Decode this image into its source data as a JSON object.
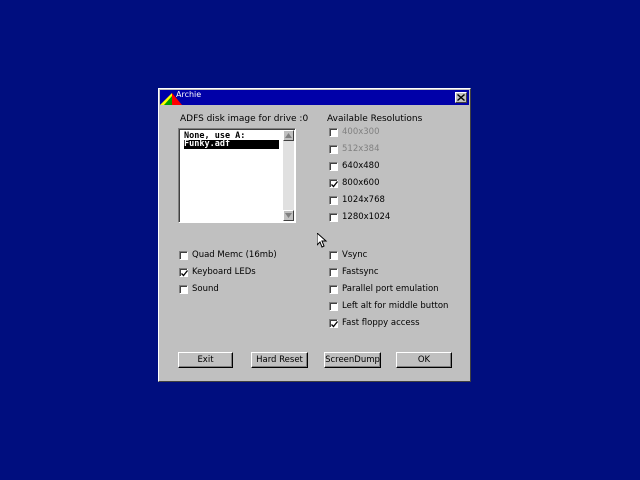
{
  "window": {
    "title": "Archie"
  },
  "disk": {
    "label": "ADFS disk image for drive :0",
    "items": [
      {
        "text": "None, use A:",
        "selected": false
      },
      {
        "text": "Funky.adf",
        "selected": true
      }
    ]
  },
  "resolutions": {
    "label": "Available Resolutions",
    "options": [
      {
        "label": "400x300",
        "checked": false,
        "enabled": false
      },
      {
        "label": "512x384",
        "checked": false,
        "enabled": false
      },
      {
        "label": "640x480",
        "checked": false,
        "enabled": true
      },
      {
        "label": "800x600",
        "checked": true,
        "enabled": true
      },
      {
        "label": "1024x768",
        "checked": false,
        "enabled": true
      },
      {
        "label": "1280x1024",
        "checked": false,
        "enabled": true
      }
    ]
  },
  "left_options": [
    {
      "label": "Quad Memc (16mb)",
      "checked": false
    },
    {
      "label": "Keyboard LEDs",
      "checked": true
    },
    {
      "label": "Sound",
      "checked": false
    }
  ],
  "right_options": [
    {
      "label": "Vsync",
      "checked": false
    },
    {
      "label": "Fastsync",
      "checked": false
    },
    {
      "label": "Parallel port emulation",
      "checked": false
    },
    {
      "label": "Left alt for middle button",
      "checked": false
    },
    {
      "label": "Fast floppy access",
      "checked": true
    }
  ],
  "buttons": {
    "exit": "Exit",
    "hard_reset": "Hard Reset",
    "screendump": "ScreenDump",
    "ok": "OK"
  },
  "icons": {
    "logo": "archie-logo-icon",
    "close": "close-icon",
    "cursor": "mouse-cursor-icon"
  },
  "colors": {
    "desktop": "#000e7f",
    "titlebar": "#0000a8",
    "dialog": "#c0c0c0"
  }
}
